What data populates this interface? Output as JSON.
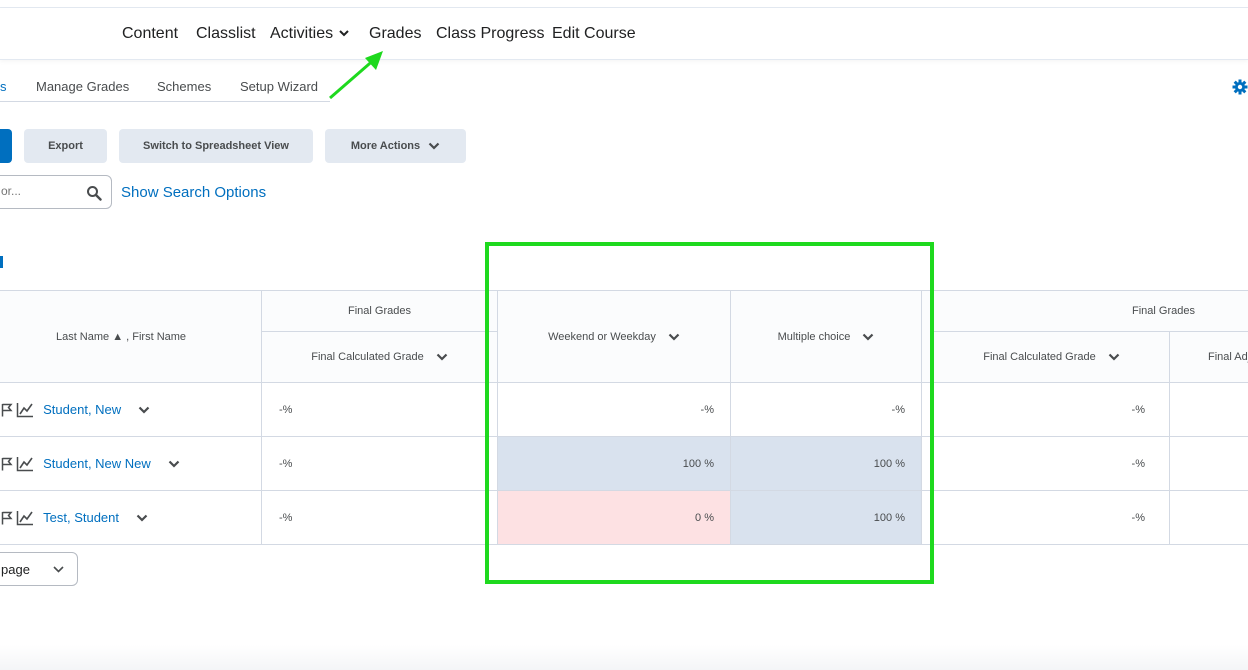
{
  "nav": {
    "items": [
      {
        "label": "Content"
      },
      {
        "label": "Classlist"
      },
      {
        "label": "Activities"
      },
      {
        "label": "Grades"
      },
      {
        "label": "Class Progress"
      },
      {
        "label": "Edit Course"
      }
    ]
  },
  "subnav": {
    "items": [
      {
        "label": "s"
      },
      {
        "label": "Manage Grades"
      },
      {
        "label": "Schemes"
      },
      {
        "label": "Setup Wizard"
      }
    ]
  },
  "toolbar": {
    "export": "Export",
    "spreadsheet": "Switch to Spreadsheet View",
    "more_actions": "More Actions"
  },
  "search": {
    "placeholder": "or...",
    "options_link": "Show Search Options"
  },
  "table": {
    "name_header": "Last Name ▲ , First Name",
    "group_final_grades": "Final Grades",
    "col_final_calculated": "Final Calculated Grade",
    "col_weekend": "Weekend or Weekday",
    "col_multiple": "Multiple choice",
    "group_final_grades_2": "Final Grades",
    "col_final_calculated_2": "Final Calculated Grade",
    "col_final_adjusted": "Final Adjus",
    "rows": [
      {
        "name": "Student, New",
        "final": "-%",
        "weekend": "-%",
        "multiple": "-%",
        "final2": "-%"
      },
      {
        "name": "Student, New New",
        "final": "-%",
        "weekend": "100 %",
        "multiple": "100 %",
        "final2": "-%"
      },
      {
        "name": "Test, Student",
        "final": "-%",
        "weekend": "0 %",
        "multiple": "100 %",
        "final2": "-%"
      }
    ]
  },
  "pagination": {
    "per_page": "page"
  },
  "colors": {
    "link": "#006fbf",
    "annotation": "#1ed91e",
    "graded_bg": "#d9e2ee",
    "failing_bg": "#fde1e3"
  }
}
